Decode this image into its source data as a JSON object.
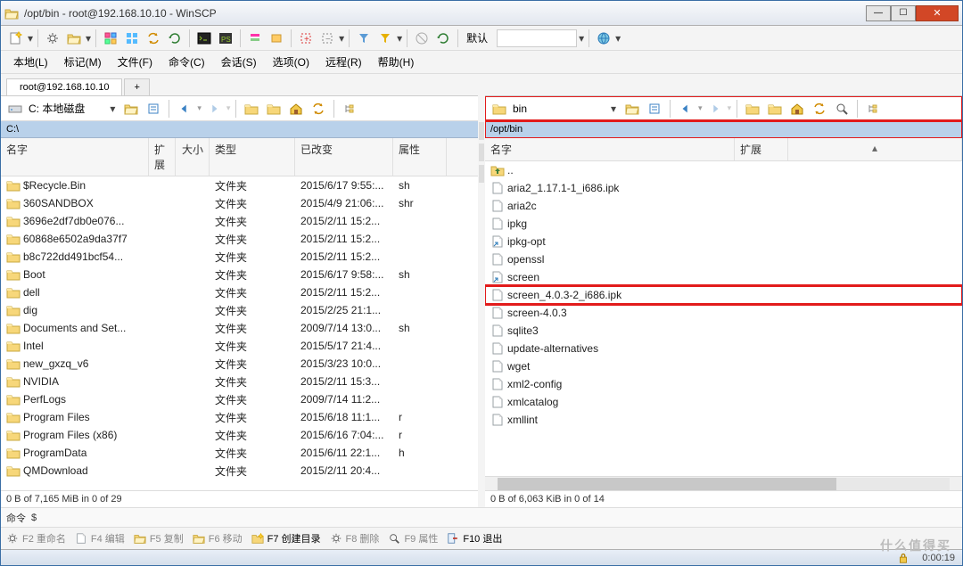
{
  "title": "/opt/bin - root@192.168.10.10 - WinSCP",
  "menus": [
    "本地(L)",
    "标记(M)",
    "文件(F)",
    "命令(C)",
    "会话(S)",
    "选项(O)",
    "远程(R)",
    "帮助(H)"
  ],
  "tab": "root@192.168.10.10",
  "toolbar_combo": "默认",
  "local": {
    "drive": "C: 本地磁盘",
    "path": "C:\\",
    "status": "0 B of 7,165 MiB in 0 of 29",
    "headers": {
      "name": "名字",
      "ext": "扩展",
      "size": "大小",
      "type": "类型",
      "changed": "已改变",
      "attr": "属性"
    },
    "files": [
      {
        "name": "$Recycle.Bin",
        "type": "文件夹",
        "changed": "2015/6/17  9:55:...",
        "attr": "sh",
        "icon": "folder"
      },
      {
        "name": "360SANDBOX",
        "type": "文件夹",
        "changed": "2015/4/9  21:06:...",
        "attr": "shr",
        "icon": "folder"
      },
      {
        "name": "3696e2df7db0e076...",
        "type": "文件夹",
        "changed": "2015/2/11  15:2...",
        "attr": "",
        "icon": "folder"
      },
      {
        "name": "60868e6502a9da37f7",
        "type": "文件夹",
        "changed": "2015/2/11  15:2...",
        "attr": "",
        "icon": "folder"
      },
      {
        "name": "b8c722dd491bcf54...",
        "type": "文件夹",
        "changed": "2015/2/11  15:2...",
        "attr": "",
        "icon": "folder"
      },
      {
        "name": "Boot",
        "type": "文件夹",
        "changed": "2015/6/17  9:58:...",
        "attr": "sh",
        "icon": "folder"
      },
      {
        "name": "dell",
        "type": "文件夹",
        "changed": "2015/2/11  15:2...",
        "attr": "",
        "icon": "folder"
      },
      {
        "name": "dig",
        "type": "文件夹",
        "changed": "2015/2/25  21:1...",
        "attr": "",
        "icon": "folder"
      },
      {
        "name": "Documents and Set...",
        "type": "文件夹",
        "changed": "2009/7/14  13:0...",
        "attr": "sh",
        "icon": "folder",
        "dim": true
      },
      {
        "name": "Intel",
        "type": "文件夹",
        "changed": "2015/5/17  21:4...",
        "attr": "",
        "icon": "folder"
      },
      {
        "name": "new_gxzq_v6",
        "type": "文件夹",
        "changed": "2015/3/23  10:0...",
        "attr": "",
        "icon": "folder"
      },
      {
        "name": "NVIDIA",
        "type": "文件夹",
        "changed": "2015/2/11  15:3...",
        "attr": "",
        "icon": "folder"
      },
      {
        "name": "PerfLogs",
        "type": "文件夹",
        "changed": "2009/7/14  11:2...",
        "attr": "",
        "icon": "folder"
      },
      {
        "name": "Program Files",
        "type": "文件夹",
        "changed": "2015/6/18  11:1...",
        "attr": "r",
        "icon": "folder"
      },
      {
        "name": "Program Files (x86)",
        "type": "文件夹",
        "changed": "2015/6/16  7:04:...",
        "attr": "r",
        "icon": "folder"
      },
      {
        "name": "ProgramData",
        "type": "文件夹",
        "changed": "2015/6/11  22:1...",
        "attr": "h",
        "icon": "folder",
        "dim": true
      },
      {
        "name": "QMDownload",
        "type": "文件夹",
        "changed": "2015/2/11  20:4...",
        "attr": "",
        "icon": "folder"
      }
    ]
  },
  "remote": {
    "folder": "bin",
    "path": "/opt/bin",
    "status": "0 B of 6,063 KiB in 0 of 14",
    "headers": {
      "name": "名字",
      "ext": "扩展"
    },
    "files": [
      {
        "name": "..",
        "icon": "up"
      },
      {
        "name": "aria2_1.17.1-1_i686.ipk",
        "icon": "file"
      },
      {
        "name": "aria2c",
        "icon": "file"
      },
      {
        "name": "ipkg",
        "icon": "file"
      },
      {
        "name": "ipkg-opt",
        "icon": "link"
      },
      {
        "name": "openssl",
        "icon": "file"
      },
      {
        "name": "screen",
        "icon": "link"
      },
      {
        "name": "screen_4.0.3-2_i686.ipk",
        "icon": "file",
        "highlight": true
      },
      {
        "name": "screen-4.0.3",
        "icon": "file"
      },
      {
        "name": "sqlite3",
        "icon": "file"
      },
      {
        "name": "update-alternatives",
        "icon": "file"
      },
      {
        "name": "wget",
        "icon": "file"
      },
      {
        "name": "xml2-config",
        "icon": "file"
      },
      {
        "name": "xmlcatalog",
        "icon": "file"
      },
      {
        "name": "xmllint",
        "icon": "file"
      }
    ]
  },
  "cmdbar": {
    "label": "命令",
    "prompt": "$"
  },
  "fkeys": [
    {
      "key": "F2",
      "label": "重命名",
      "ico": "rename"
    },
    {
      "key": "F4",
      "label": "编辑",
      "ico": "edit"
    },
    {
      "key": "F5",
      "label": "复制",
      "ico": "copy"
    },
    {
      "key": "F6",
      "label": "移动",
      "ico": "move"
    },
    {
      "key": "F7",
      "label": "创建目录",
      "ico": "newdir",
      "active": true
    },
    {
      "key": "F8",
      "label": "删除",
      "ico": "delete"
    },
    {
      "key": "F9",
      "label": "属性",
      "ico": "props"
    },
    {
      "key": "F10",
      "label": "退出",
      "ico": "exit",
      "active": true
    }
  ],
  "footer": {
    "time": "0:00:19"
  },
  "watermark": "什么值得买"
}
